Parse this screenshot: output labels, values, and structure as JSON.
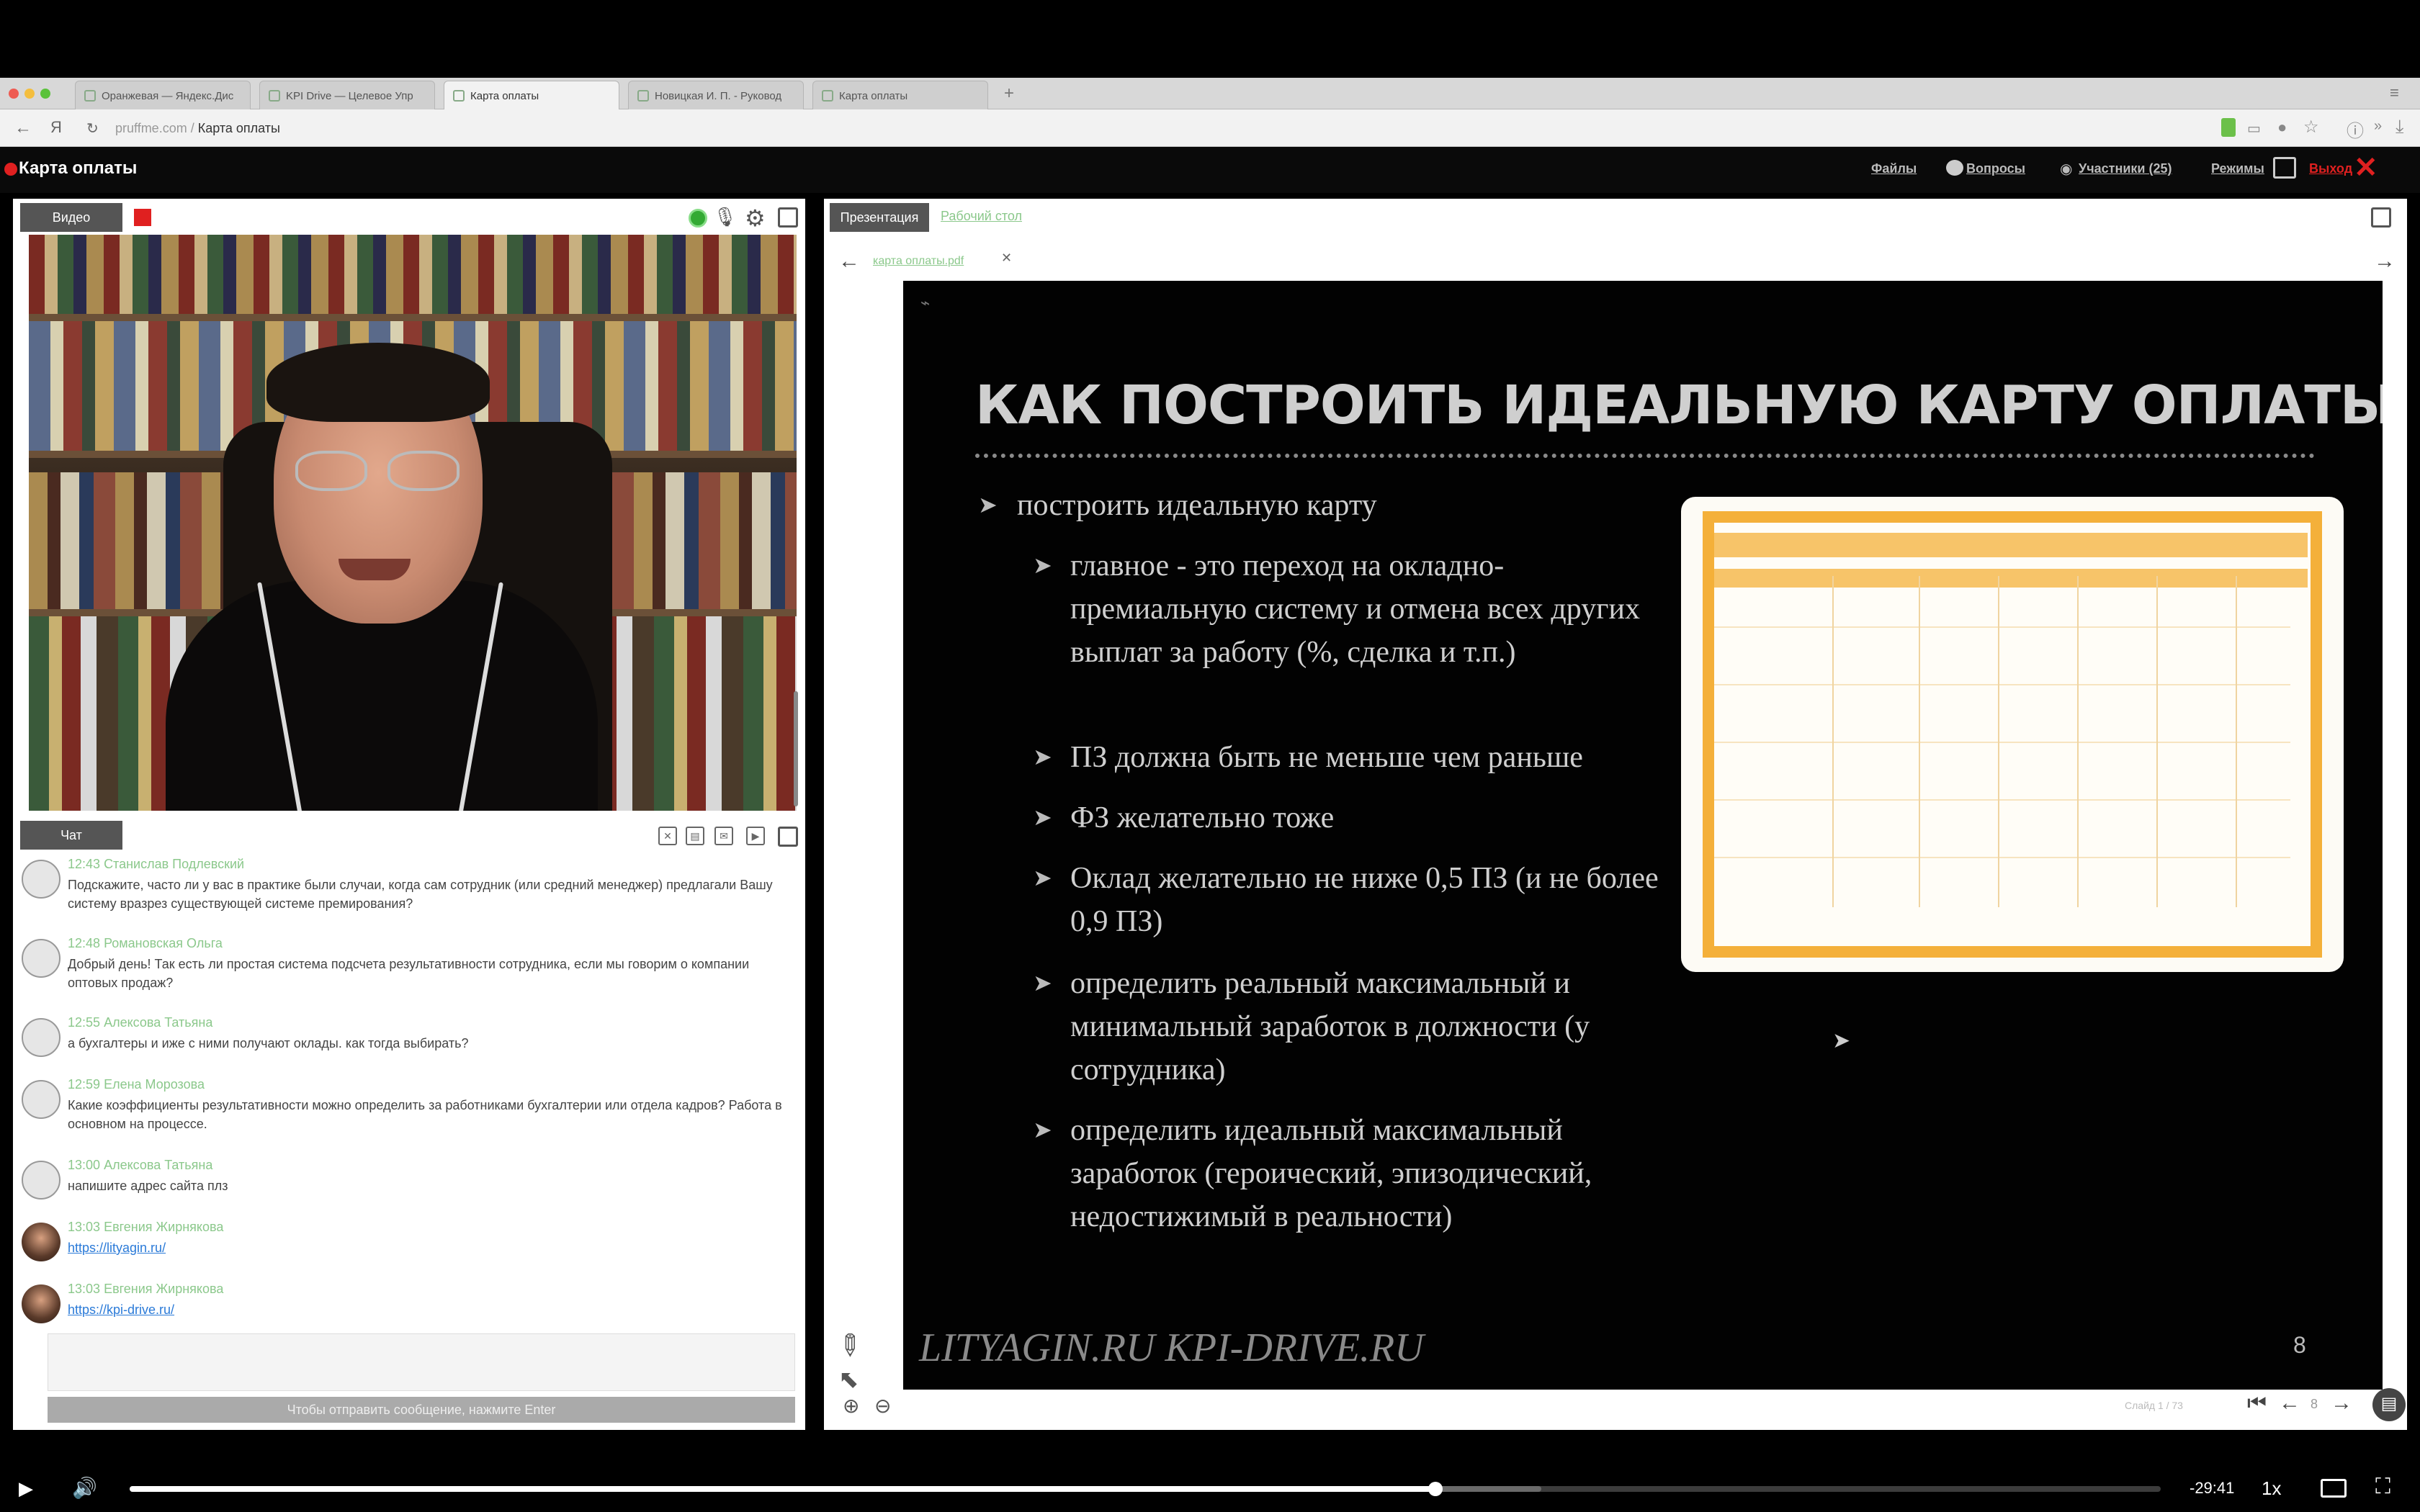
{
  "browser": {
    "tabs": [
      {
        "label": "Оранжевая — Яндекс.Дис"
      },
      {
        "label": "KPI Drive — Целевое Упр"
      },
      {
        "label": "Карта оплаты"
      },
      {
        "label": "Новицкая И. П. - Руковод"
      },
      {
        "label": "Карта оплаты"
      }
    ],
    "url_host": "pruffme.com",
    "url_sep": "/",
    "url_title": "Карта оплаты"
  },
  "app": {
    "title": "Карта оплаты",
    "header_links": {
      "files": "Файлы",
      "questions": "Вопросы",
      "participants": "Участники (25)",
      "modes": "Режимы",
      "exit": "Выход"
    },
    "accent_color": "#e02020"
  },
  "left": {
    "video_tab": "Видео",
    "chat_tab": "Чат",
    "chat_messages": [
      {
        "time": "12:43",
        "author": "Станислав Подлевский",
        "text": "Подскажите, часто ли у вас в практике были случаи, когда сам сотрудник (или средний менеджер) предлагали Вашу систему вразрез существующей системе премирования?"
      },
      {
        "time": "12:48",
        "author": "Романовская Ольга",
        "text": "Добрый день! Так есть ли простая система подсчета результативности сотрудника, если мы говорим о компании оптовых продаж?"
      },
      {
        "time": "12:55",
        "author": "Алексова Татьяна",
        "text": "а бухгалтеры и иже с ними получают оклады. как тогда выбирать?"
      },
      {
        "time": "12:59",
        "author": "Елена Морозова",
        "text": "Какие коэффициенты результативности можно определить за работниками бухгалтерии или отдела кадров? Работа в основном на процессе."
      },
      {
        "time": "13:00",
        "author": "Алексова Татьяна",
        "text": "напишите адрес сайта плз"
      },
      {
        "time": "13:03",
        "author": "Евгения Жирнякова",
        "text": "https://lityagin.ru/"
      },
      {
        "time": "13:03",
        "author": "Евгения Жирнякова",
        "text": "https://kpi-drive.ru/"
      }
    ],
    "input_hint": "Чтобы отправить сообщение, нажмите Enter"
  },
  "right": {
    "tab_presentation": "Презентация",
    "tab_desktop": "Рабочий стол",
    "file_tab": "карта оплаты.pdf",
    "slide": {
      "title": "КАК ПОСТРОИТЬ ИДЕАЛЬНУЮ КАРТУ ОПЛАТЫ",
      "bullet_top": "построить идеальную карту",
      "sub_bullets": [
        "главное - это переход на окладно-премиальную систему и отмена всех других выплат за работу (%, сделка и т.п.)",
        "ПЗ должна быть не меньше чем раньше",
        "ФЗ желательно тоже",
        "Оклад желательно не ниже 0,5 ПЗ (и не более 0,9 ПЗ)",
        "определить реальный максимальный и минимальный заработок в должности (у сотрудника)",
        "определить идеальный максимальный заработок (героический, эпизодический, недостижимый в реальности)"
      ],
      "footer": "LITYAGIN.RU  KPI-DRIVE.RU",
      "number": "8"
    },
    "pager_label": "Слайд 1 / 73",
    "page_current": "8"
  },
  "player": {
    "time_remaining": "-29:41",
    "speed": "1x",
    "progress": 0.643,
    "buffered": 0.695
  }
}
